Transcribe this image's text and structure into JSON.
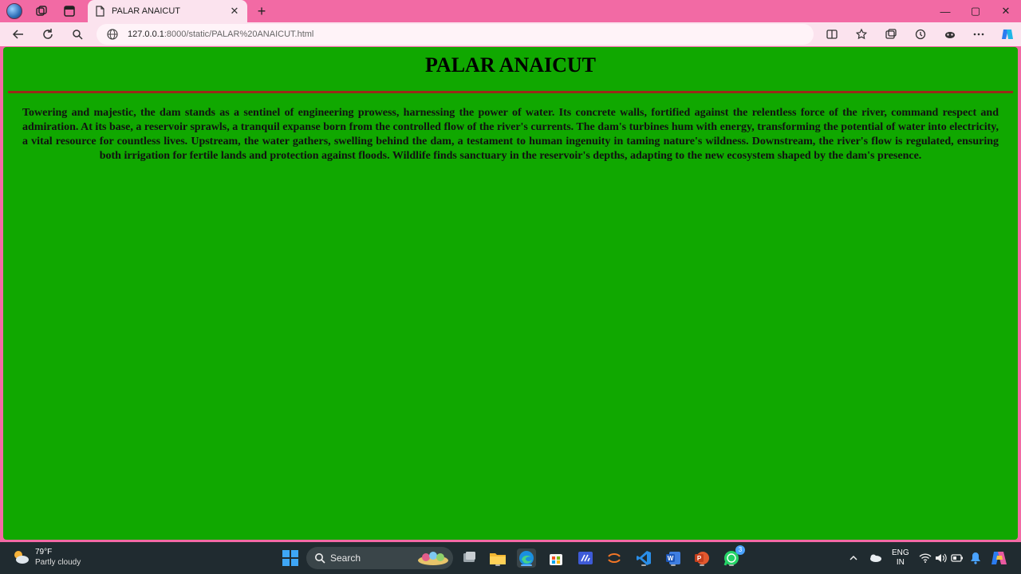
{
  "browser": {
    "tab": {
      "title": "PALAR ANAICUT",
      "close": "✕"
    },
    "new_tab": "+",
    "window_controls": {
      "minimize": "—",
      "maximize": "▢",
      "close": "✕"
    },
    "address": {
      "host": "127.0.0.1",
      "rest": ":8000/static/PALAR%20ANAICUT.html"
    }
  },
  "page": {
    "title": "PALAR ANAICUT",
    "body": "Towering and majestic, the dam stands as a sentinel of engineering prowess, harnessing the power of water. Its concrete walls, fortified against the relentless force of the river, command respect and admiration. At its base, a reservoir sprawls, a tranquil expanse born from the controlled flow of the river's currents. The dam's turbines hum with energy, transforming the potential of water into electricity, a vital resource for countless lives. Upstream, the water gathers, swelling behind the dam, a testament to human ingenuity in taming nature's wildness. Downstream, the river's flow is regulated, ensuring both irrigation for fertile lands and protection against floods. Wildlife finds sanctuary in the reservoir's depths, adapting to the new ecosystem shaped by the dam's presence.",
    "background_color": "#10a800",
    "rule_color": "#9a2a18"
  },
  "taskbar": {
    "weather": {
      "temp": "79°F",
      "condition": "Partly cloudy"
    },
    "search_label": "Search",
    "whatsapp_badge": "3",
    "language": {
      "line1": "ENG",
      "line2": "IN"
    }
  },
  "colors": {
    "tab_strip": "#f26aa4",
    "toolbar": "#fbe3ee",
    "taskbar": "#202b30"
  }
}
